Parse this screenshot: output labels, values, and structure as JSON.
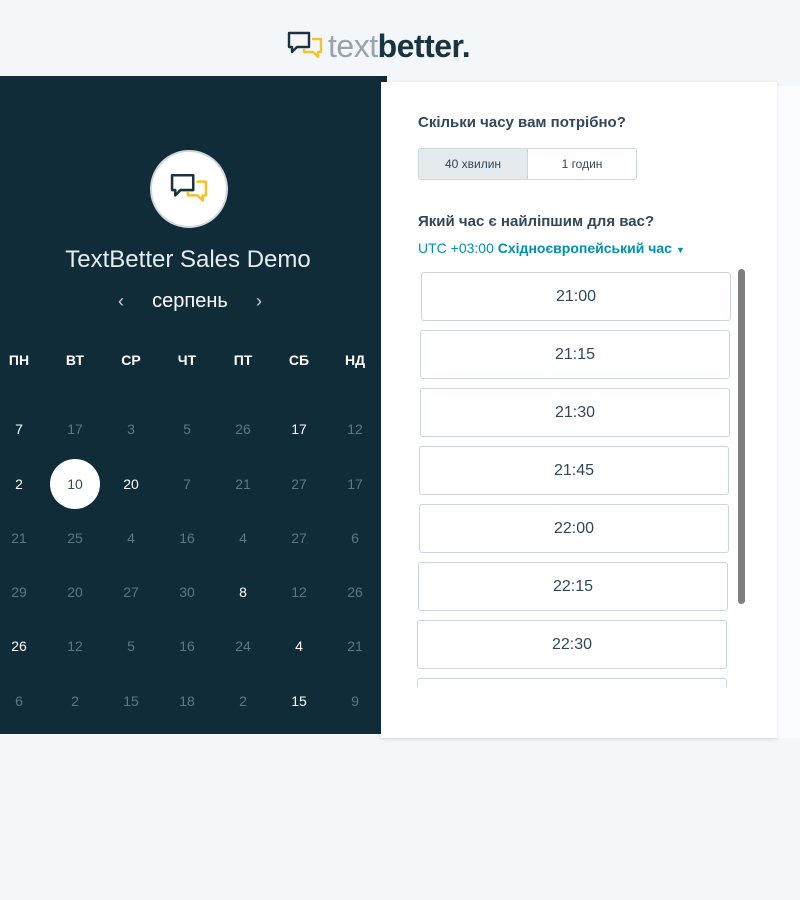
{
  "logo": {
    "part1": "text",
    "part2": "better",
    "dot": "."
  },
  "company": "TextBetter Sales Demo",
  "calendar": {
    "month": "серпень",
    "weekdays": [
      "ПН",
      "ВТ",
      "СР",
      "ЧТ",
      "ПТ",
      "СБ",
      "НД"
    ],
    "weeks": [
      [
        "7",
        "17",
        "3",
        "5",
        "26",
        "17",
        "12"
      ],
      [
        "2",
        "10",
        "20",
        "7",
        "21",
        "27",
        "17"
      ],
      [
        "21",
        "25",
        "4",
        "16",
        "4",
        "27",
        "6"
      ],
      [
        "29",
        "20",
        "27",
        "30",
        "8",
        "12",
        "26"
      ],
      [
        "26",
        "12",
        "5",
        "16",
        "24",
        "4",
        "21"
      ],
      [
        "6",
        "2",
        "15",
        "18",
        "2",
        "15",
        "9"
      ]
    ]
  },
  "duration": {
    "question": "Скільки часу вам потрібно?",
    "options": [
      "40 хвилин",
      "1 годин"
    ],
    "selected": "40 хвилин"
  },
  "time": {
    "question": "Який час є найліпшим для вас?",
    "tz_offset": "UTC +03:00",
    "tz_name": "Східноєвропейський час",
    "slots": [
      "21:00",
      "21:15",
      "21:30",
      "21:45",
      "22:00",
      "22:15",
      "22:30",
      ""
    ]
  },
  "colors": {
    "panel_bg": "#0f2c38",
    "accent": "#0091ae",
    "logo_yellow": "#f5c227"
  }
}
